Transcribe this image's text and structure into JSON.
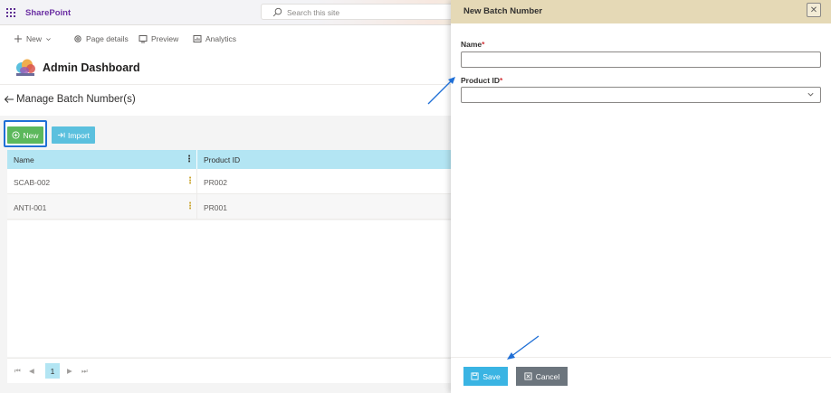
{
  "suite": {
    "brand": "SharePoint",
    "search_placeholder": "Search this site"
  },
  "command_bar": {
    "new": "New",
    "page_details": "Page details",
    "preview": "Preview",
    "analytics": "Analytics"
  },
  "site": {
    "title": "Admin Dashboard"
  },
  "page": {
    "title": "Manage Batch Number(s)"
  },
  "toolbar": {
    "new_label": "New",
    "import_label": "Import"
  },
  "table": {
    "columns": [
      "Name",
      "Product ID"
    ],
    "rows": [
      {
        "name": "SCAB-002",
        "product_id": "PR002"
      },
      {
        "name": "ANTI-001",
        "product_id": "PR001"
      }
    ]
  },
  "pager": {
    "current": "1"
  },
  "panel": {
    "title": "New Batch Number",
    "name_label": "Name",
    "product_label": "Product ID",
    "required_mark": "*",
    "close_glyph": "✕",
    "save_label": "Save",
    "cancel_label": "Cancel"
  },
  "colors": {
    "accent_purple": "#6b2fa3",
    "new_green": "#5cb85c",
    "import_cyan": "#5bc0de",
    "save_blue": "#3ab4e3",
    "cancel_gray": "#6c757d",
    "panel_header": "#e5d9b6",
    "table_header": "#b3e5f3"
  }
}
